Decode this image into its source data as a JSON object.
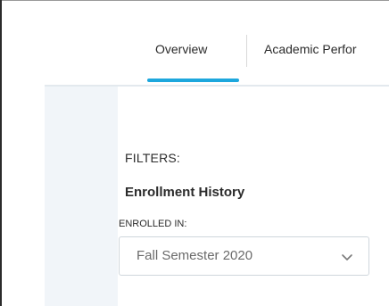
{
  "tabs": {
    "overview_label": "Overview",
    "academic_label": "Academic Perfor",
    "active": "Overview"
  },
  "filters": {
    "heading": "FILTERS:",
    "section_title": "Enrollment History",
    "enrolled_in": {
      "label": "ENROLLED IN:",
      "selected_value": "Fall Semester 2020"
    }
  },
  "icons": {
    "dropdown": "chevron-down-icon"
  },
  "colors": {
    "accent": "#1da7dd",
    "side_rail": "#f1f5f9",
    "text": "#2b2b2b",
    "muted_text": "#6b6b6b"
  }
}
